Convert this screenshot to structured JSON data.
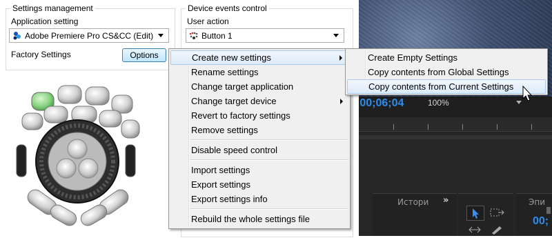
{
  "settings_management": {
    "title": "Settings management",
    "app_setting_label": "Application setting",
    "app_setting_value": "Adobe Premiere Pro CS&CC (Edit)",
    "factory_label": "Factory Settings",
    "options_button": "Options"
  },
  "device_events": {
    "title": "Device events control",
    "user_action_label": "User action",
    "user_action_value": "Button 1"
  },
  "editor": {
    "timecode_left": ";00;06;04",
    "zoom": "100%",
    "history_tab": "Истори",
    "right_tab": "Эпи",
    "timecode_bottom": "00;",
    "expand_glyph": "»"
  },
  "context_menu": {
    "items": [
      {
        "label": "Create new settings",
        "submenu": true,
        "highlighted": true
      },
      {
        "label": "Rename settings"
      },
      {
        "label": "Change target application"
      },
      {
        "label": "Change target device",
        "submenu": true
      },
      {
        "label": "Revert to factory settings"
      },
      {
        "label": "Remove settings"
      },
      {
        "label": "Disable speed control"
      },
      {
        "label": "Import settings"
      },
      {
        "label": "Export settings"
      },
      {
        "label": "Export settings info"
      },
      {
        "label": "Rebuild the whole settings file"
      }
    ]
  },
  "submenu": {
    "items": [
      {
        "label": "Create Empty Settings"
      },
      {
        "label": "Copy contents from Global Settings"
      },
      {
        "label": "Copy contents from Current Settings",
        "highlighted": true
      }
    ]
  },
  "colors": {
    "highlight_border": "#a8cbee",
    "editor_bg": "#262626",
    "timecode": "#2d8ceb",
    "active_key": "#7fd37a"
  },
  "icons": [
    "premiere-app-icon",
    "device-button-icon",
    "mouse-cursor-icon",
    "selection-tool-icon",
    "track-select-tool-icon"
  ]
}
